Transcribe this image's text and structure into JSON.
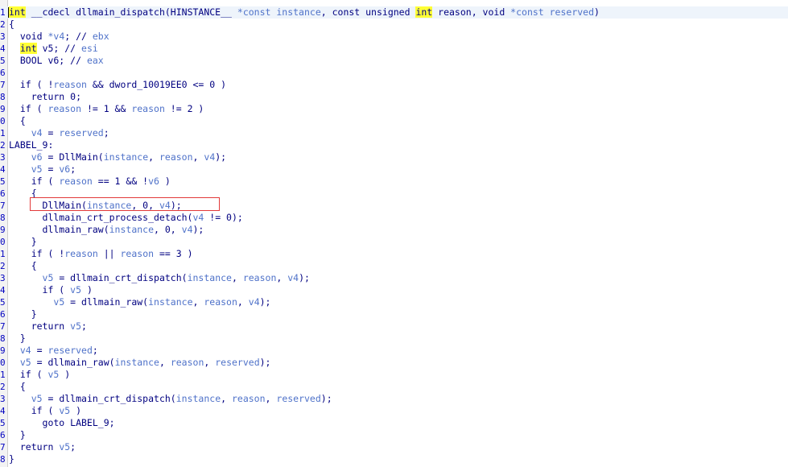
{
  "editor": {
    "lines": [
      {
        "n": "1",
        "tokens": [
          [
            "int",
            "kw"
          ],
          [
            " __cdecl dllmain_dispatch(HINSTANCE__ ",
            "pl"
          ],
          [
            "*const instance",
            "var"
          ],
          [
            ", const unsigned ",
            "pl"
          ],
          [
            "int",
            "kw"
          ],
          [
            " reason, void ",
            "pl"
          ],
          [
            "*const reserved",
            "var"
          ],
          [
            ")",
            "pl"
          ]
        ]
      },
      {
        "n": "2",
        "tokens": [
          [
            "{",
            "pl"
          ]
        ]
      },
      {
        "n": "3",
        "tokens": [
          [
            "  void ",
            "pl"
          ],
          [
            "*v4",
            "var"
          ],
          [
            "; // ",
            "pl"
          ],
          [
            "ebx",
            "cm"
          ]
        ]
      },
      {
        "n": "4",
        "tokens": [
          [
            "  ",
            "pl"
          ],
          [
            "int",
            "kw"
          ],
          [
            " v5; // ",
            "pl"
          ],
          [
            "esi",
            "cm"
          ]
        ]
      },
      {
        "n": "5",
        "tokens": [
          [
            "  BOOL v6; // ",
            "pl"
          ],
          [
            "eax",
            "cm"
          ]
        ]
      },
      {
        "n": "6",
        "tokens": []
      },
      {
        "n": "7",
        "tokens": [
          [
            "  if ( !",
            "pl"
          ],
          [
            "reason",
            "var"
          ],
          [
            " && dword_10019EE0 <= 0 )",
            "pl"
          ]
        ]
      },
      {
        "n": "8",
        "tokens": [
          [
            "    return 0;",
            "pl"
          ]
        ]
      },
      {
        "n": "9",
        "tokens": [
          [
            "  if ( ",
            "pl"
          ],
          [
            "reason",
            "var"
          ],
          [
            " != 1 && ",
            "pl"
          ],
          [
            "reason",
            "var"
          ],
          [
            " != 2 )",
            "pl"
          ]
        ]
      },
      {
        "n": "0",
        "tokens": [
          [
            "  {",
            "pl"
          ]
        ]
      },
      {
        "n": "1",
        "tokens": [
          [
            "    ",
            "pl"
          ],
          [
            "v4",
            "var"
          ],
          [
            " = ",
            "pl"
          ],
          [
            "reserved",
            "var"
          ],
          [
            ";",
            "pl"
          ]
        ]
      },
      {
        "n": "2",
        "tokens": [
          [
            "LABEL_9:",
            "pl"
          ]
        ]
      },
      {
        "n": "3",
        "tokens": [
          [
            "    ",
            "pl"
          ],
          [
            "v6",
            "var"
          ],
          [
            " = DllMain(",
            "pl"
          ],
          [
            "instance",
            "var"
          ],
          [
            ", ",
            "pl"
          ],
          [
            "reason",
            "var"
          ],
          [
            ", ",
            "pl"
          ],
          [
            "v4",
            "var"
          ],
          [
            ");",
            "pl"
          ]
        ]
      },
      {
        "n": "4",
        "tokens": [
          [
            "    ",
            "pl"
          ],
          [
            "v5",
            "var"
          ],
          [
            " = ",
            "pl"
          ],
          [
            "v6",
            "var"
          ],
          [
            ";",
            "pl"
          ]
        ]
      },
      {
        "n": "5",
        "tokens": [
          [
            "    if ( ",
            "pl"
          ],
          [
            "reason",
            "var"
          ],
          [
            " == 1 && !",
            "pl"
          ],
          [
            "v6",
            "var"
          ],
          [
            " )",
            "pl"
          ]
        ]
      },
      {
        "n": "6",
        "tokens": [
          [
            "    {",
            "pl"
          ]
        ]
      },
      {
        "n": "7",
        "tokens": [
          [
            "      DllMain(",
            "pl"
          ],
          [
            "instance",
            "var"
          ],
          [
            ", 0, ",
            "pl"
          ],
          [
            "v4",
            "var"
          ],
          [
            ");",
            "pl"
          ]
        ]
      },
      {
        "n": "8",
        "tokens": [
          [
            "      dllmain_crt_process_detach(",
            "pl"
          ],
          [
            "v4",
            "var"
          ],
          [
            " != 0);",
            "pl"
          ]
        ]
      },
      {
        "n": "9",
        "tokens": [
          [
            "      dllmain_raw(",
            "pl"
          ],
          [
            "instance",
            "var"
          ],
          [
            ", 0, ",
            "pl"
          ],
          [
            "v4",
            "var"
          ],
          [
            ");",
            "pl"
          ]
        ]
      },
      {
        "n": "0",
        "tokens": [
          [
            "    }",
            "pl"
          ]
        ]
      },
      {
        "n": "1",
        "tokens": [
          [
            "    if ( !",
            "pl"
          ],
          [
            "reason",
            "var"
          ],
          [
            " || ",
            "pl"
          ],
          [
            "reason",
            "var"
          ],
          [
            " == 3 )",
            "pl"
          ]
        ]
      },
      {
        "n": "2",
        "tokens": [
          [
            "    {",
            "pl"
          ]
        ]
      },
      {
        "n": "3",
        "tokens": [
          [
            "      ",
            "pl"
          ],
          [
            "v5",
            "var"
          ],
          [
            " = dllmain_crt_dispatch(",
            "pl"
          ],
          [
            "instance",
            "var"
          ],
          [
            ", ",
            "pl"
          ],
          [
            "reason",
            "var"
          ],
          [
            ", ",
            "pl"
          ],
          [
            "v4",
            "var"
          ],
          [
            ");",
            "pl"
          ]
        ]
      },
      {
        "n": "4",
        "tokens": [
          [
            "      if ( ",
            "pl"
          ],
          [
            "v5",
            "var"
          ],
          [
            " )",
            "pl"
          ]
        ]
      },
      {
        "n": "5",
        "tokens": [
          [
            "        ",
            "pl"
          ],
          [
            "v5",
            "var"
          ],
          [
            " = dllmain_raw(",
            "pl"
          ],
          [
            "instance",
            "var"
          ],
          [
            ", ",
            "pl"
          ],
          [
            "reason",
            "var"
          ],
          [
            ", ",
            "pl"
          ],
          [
            "v4",
            "var"
          ],
          [
            ");",
            "pl"
          ]
        ]
      },
      {
        "n": "6",
        "tokens": [
          [
            "    }",
            "pl"
          ]
        ]
      },
      {
        "n": "7",
        "tokens": [
          [
            "    return ",
            "pl"
          ],
          [
            "v5",
            "var"
          ],
          [
            ";",
            "pl"
          ]
        ]
      },
      {
        "n": "8",
        "tokens": [
          [
            "  }",
            "pl"
          ]
        ]
      },
      {
        "n": "9",
        "tokens": [
          [
            "  ",
            "pl"
          ],
          [
            "v4",
            "var"
          ],
          [
            " = ",
            "pl"
          ],
          [
            "reserved",
            "var"
          ],
          [
            ";",
            "pl"
          ]
        ]
      },
      {
        "n": "0",
        "tokens": [
          [
            "  ",
            "pl"
          ],
          [
            "v5",
            "var"
          ],
          [
            " = dllmain_raw(",
            "pl"
          ],
          [
            "instance",
            "var"
          ],
          [
            ", ",
            "pl"
          ],
          [
            "reason",
            "var"
          ],
          [
            ", ",
            "pl"
          ],
          [
            "reserved",
            "var"
          ],
          [
            ");",
            "pl"
          ]
        ]
      },
      {
        "n": "1",
        "tokens": [
          [
            "  if ( ",
            "pl"
          ],
          [
            "v5",
            "var"
          ],
          [
            " )",
            "pl"
          ]
        ]
      },
      {
        "n": "2",
        "tokens": [
          [
            "  {",
            "pl"
          ]
        ]
      },
      {
        "n": "3",
        "tokens": [
          [
            "    ",
            "pl"
          ],
          [
            "v5",
            "var"
          ],
          [
            " = dllmain_crt_dispatch(",
            "pl"
          ],
          [
            "instance",
            "var"
          ],
          [
            ", ",
            "pl"
          ],
          [
            "reason",
            "var"
          ],
          [
            ", ",
            "pl"
          ],
          [
            "reserved",
            "var"
          ],
          [
            ");",
            "pl"
          ]
        ]
      },
      {
        "n": "4",
        "tokens": [
          [
            "    if ( ",
            "pl"
          ],
          [
            "v5",
            "var"
          ],
          [
            " )",
            "pl"
          ]
        ]
      },
      {
        "n": "5",
        "tokens": [
          [
            "      goto LABEL_9;",
            "pl"
          ]
        ]
      },
      {
        "n": "6",
        "tokens": [
          [
            "  }",
            "pl"
          ]
        ]
      },
      {
        "n": "7",
        "tokens": [
          [
            "  return ",
            "pl"
          ],
          [
            "v5",
            "var"
          ],
          [
            ";",
            "pl"
          ]
        ]
      },
      {
        "n": "8",
        "tokens": [
          [
            "}",
            "pl"
          ]
        ]
      }
    ],
    "highlighted_keyword": "int",
    "colors": {
      "keyword": "#000080",
      "variable": "#4f72c9",
      "comment": "#4f72c9",
      "highlight": "#ffff35",
      "selection_border": "#e23a3a",
      "line_numbers": "#0000c0"
    }
  }
}
